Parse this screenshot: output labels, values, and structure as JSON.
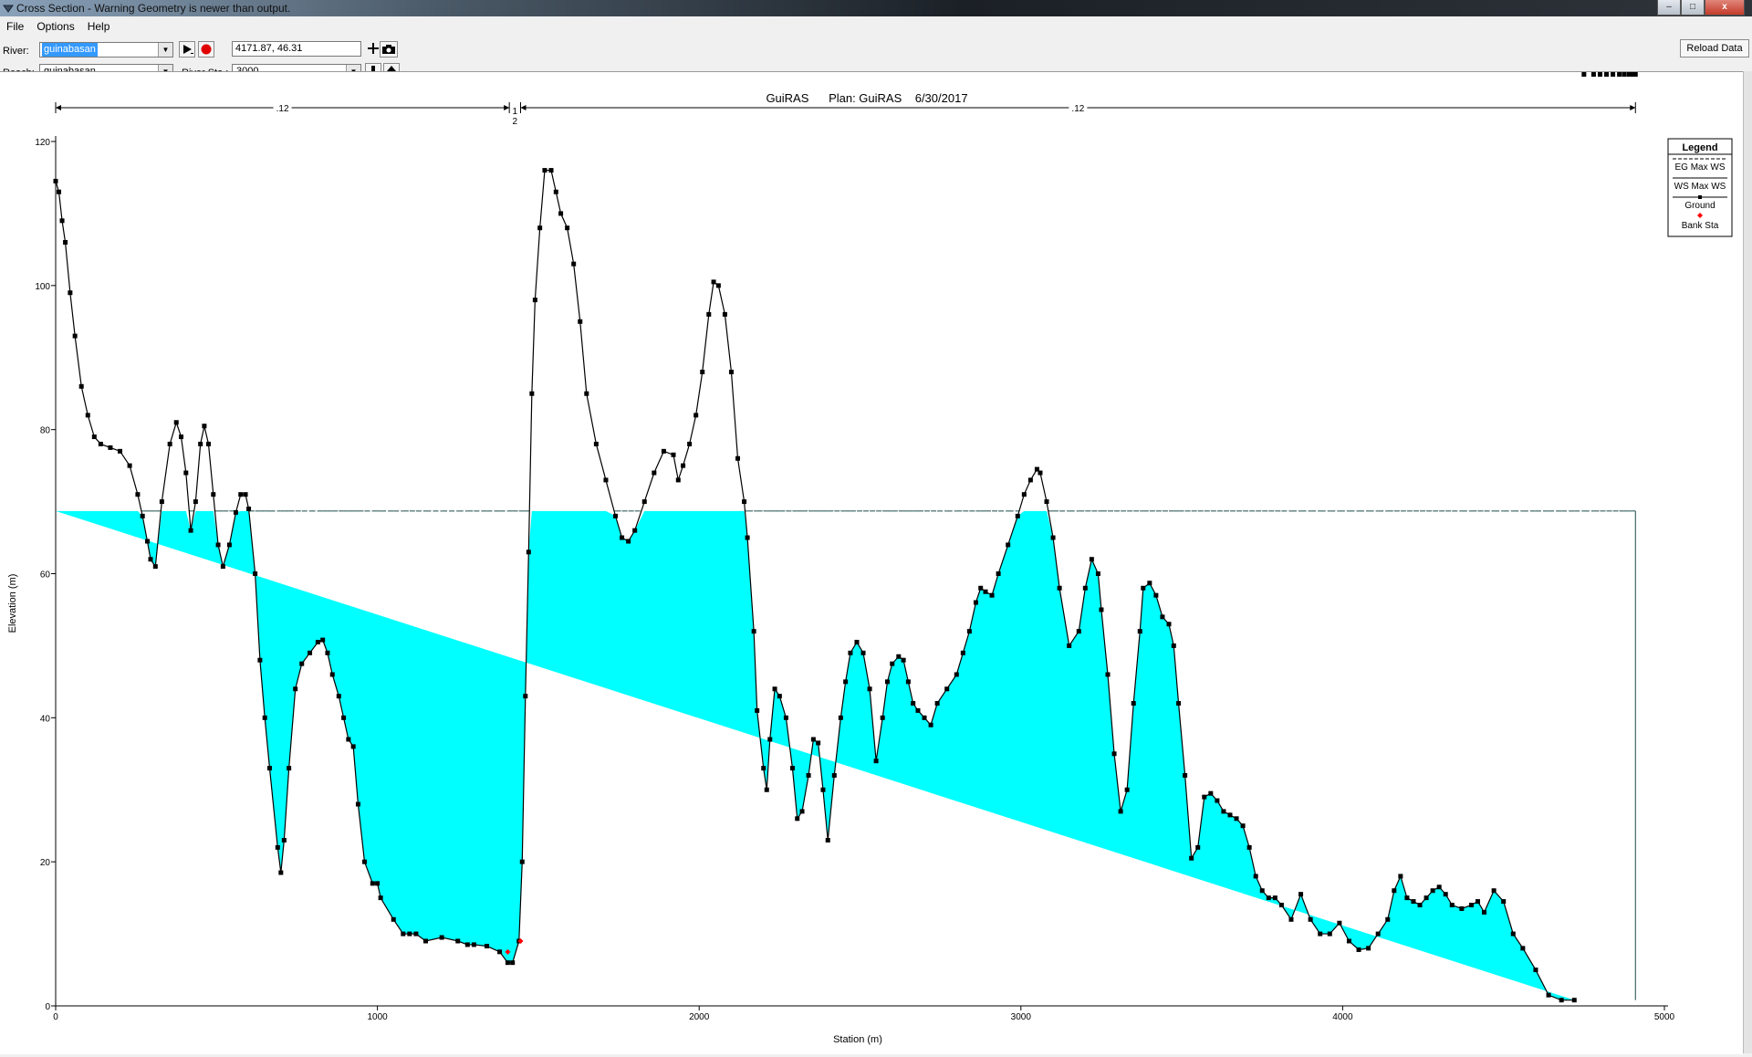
{
  "window": {
    "title": "Cross Section - Warning Geometry is newer than output.",
    "minimize": "–",
    "maximize": "□",
    "close": "x"
  },
  "menu": [
    "File",
    "Options",
    "Help"
  ],
  "controls": {
    "river_label": "River:",
    "river_value": "guinabasan",
    "reach_label": "Reach:",
    "reach_value": "guinabasan",
    "river_sta_label": "River Sta.:",
    "river_sta_value": "3000",
    "coordinates": "4171.87, 46.31",
    "reload_label": "Reload Data",
    "icons": [
      "play-icon",
      "record-icon",
      "plus-icon",
      "camera-icon",
      "down-arrow-icon",
      "up-arrow-icon"
    ]
  },
  "chart_data": {
    "type": "area",
    "title": "GuiRAS      Plan: GuiRAS    6/30/2017",
    "xlabel": "Station (m)",
    "ylabel": "Elevation (m)",
    "xlim": [
      0,
      5000
    ],
    "ylim": [
      0,
      120
    ],
    "xticks": [
      0,
      1000,
      2000,
      3000,
      4000,
      5000
    ],
    "yticks": [
      0,
      20,
      40,
      60,
      80,
      100,
      120
    ],
    "grid": false,
    "water_surface_elevation": 68.7,
    "water_surface_extent": [
      0,
      4910
    ],
    "colors": {
      "water": "#00ffff",
      "ground": "#000000",
      "bank": "#ff0000"
    },
    "manning": [
      {
        "label": ".12",
        "from": 0,
        "to": 1410
      },
      {
        "label": ".12",
        "from": 1445,
        "to": 4910
      }
    ],
    "bank_marker_labels": [
      "1",
      "2"
    ],
    "bank_stations": [
      [
        1405,
        7.5
      ],
      [
        1445,
        9
      ]
    ],
    "legend": {
      "title": "Legend",
      "position": "top-right",
      "entries": [
        "EG Max WS",
        "WS Max WS",
        "Ground",
        "Bank Sta"
      ]
    },
    "ground": {
      "x": [
        0,
        10,
        20,
        30,
        45,
        60,
        80,
        100,
        120,
        140,
        170,
        200,
        230,
        255,
        270,
        285,
        295,
        310,
        330,
        355,
        375,
        390,
        405,
        420,
        435,
        450,
        462,
        475,
        490,
        505,
        520,
        540,
        560,
        575,
        590,
        600,
        620,
        635,
        650,
        665,
        690,
        700,
        710,
        725,
        745,
        765,
        790,
        815,
        830,
        845,
        860,
        880,
        895,
        910,
        925,
        940,
        960,
        985,
        1000,
        1010,
        1050,
        1080,
        1100,
        1120,
        1150,
        1200,
        1250,
        1280,
        1300,
        1340,
        1380,
        1405,
        1420,
        1440,
        1450,
        1460,
        1470,
        1480,
        1490,
        1505,
        1520,
        1540,
        1555,
        1570,
        1590,
        1610,
        1630,
        1650,
        1680,
        1710,
        1740,
        1760,
        1780,
        1800,
        1830,
        1860,
        1890,
        1920,
        1935,
        1950,
        1970,
        1990,
        2010,
        2030,
        2045,
        2060,
        2080,
        2100,
        2120,
        2140,
        2150,
        2170,
        2180,
        2200,
        2210,
        2220,
        2235,
        2250,
        2270,
        2290,
        2305,
        2320,
        2340,
        2355,
        2370,
        2385,
        2400,
        2420,
        2440,
        2455,
        2470,
        2490,
        2510,
        2530,
        2550,
        2570,
        2585,
        2600,
        2620,
        2635,
        2650,
        2665,
        2680,
        2700,
        2720,
        2740,
        2770,
        2800,
        2820,
        2840,
        2860,
        2875,
        2890,
        2910,
        2930,
        2960,
        2990,
        3010,
        3030,
        3050,
        3060,
        3080,
        3100,
        3120,
        3150,
        3180,
        3200,
        3220,
        3240,
        3250,
        3270,
        3290,
        3310,
        3330,
        3350,
        3370,
        3380,
        3400,
        3420,
        3440,
        3460,
        3475,
        3490,
        3510,
        3530,
        3550,
        3570,
        3590,
        3610,
        3630,
        3650,
        3670,
        3690,
        3710,
        3730,
        3750,
        3770,
        3790,
        3810,
        3840,
        3870,
        3900,
        3930,
        3960,
        3990,
        4020,
        4050,
        4080,
        4110,
        4140,
        4160,
        4180,
        4200,
        4220,
        4240,
        4260,
        4280,
        4300,
        4320,
        4340,
        4370,
        4400,
        4420,
        4440,
        4470,
        4500,
        4530,
        4560,
        4600,
        4640,
        4680,
        4720,
        4750,
        4780,
        4800,
        4820,
        4840,
        4860,
        4875,
        4890,
        4900,
        4910
      ],
      "y": [
        114.5,
        113,
        109,
        106,
        99,
        93,
        86,
        82,
        79,
        78,
        77.5,
        77,
        75,
        71,
        68,
        64.5,
        62,
        61,
        70,
        78,
        81,
        79,
        74,
        66,
        70,
        78,
        80.5,
        78,
        71,
        64,
        61,
        64,
        68.5,
        71,
        71,
        69,
        60,
        48,
        40,
        33,
        22,
        18.5,
        23,
        33,
        44,
        47.5,
        49,
        50.5,
        50.8,
        49,
        46,
        43,
        40,
        37,
        36,
        28,
        20,
        17,
        17,
        15,
        12,
        10,
        10,
        10,
        9,
        9.5,
        9,
        8.5,
        8.5,
        8.3,
        7.5,
        6,
        6,
        9,
        20,
        43,
        63,
        85,
        98,
        108,
        116,
        116,
        113,
        110,
        108,
        103,
        95,
        85,
        78,
        73,
        68,
        65,
        64.5,
        66,
        70,
        74,
        77,
        76.5,
        73,
        75,
        78,
        82,
        88,
        96,
        100.5,
        100,
        96,
        88,
        76,
        70,
        65,
        52,
        41,
        33,
        30,
        37,
        44,
        43,
        40,
        33,
        26,
        27,
        32,
        37,
        36.5,
        30,
        23,
        32,
        40,
        45,
        49,
        50.5,
        49,
        44,
        34,
        40,
        45,
        47.5,
        48.5,
        48,
        45,
        42,
        41,
        40,
        39,
        42,
        44,
        46,
        49,
        52,
        56,
        58,
        57.5,
        57,
        60,
        64,
        68,
        71,
        73,
        74.5,
        74,
        70,
        65,
        58,
        50,
        52,
        58,
        62,
        60,
        55,
        46,
        35,
        27,
        30,
        42,
        52,
        58,
        58.7,
        57,
        54,
        53,
        50,
        42,
        32,
        20.5,
        22,
        29,
        29.5,
        28.5,
        27,
        26.5,
        26,
        25,
        22,
        18,
        16,
        15,
        15,
        14,
        12,
        15.5,
        12,
        10,
        10,
        11.5,
        9,
        7.8,
        8,
        10,
        12,
        16,
        18,
        15,
        14.5,
        14,
        15,
        16,
        16.5,
        15.5,
        14,
        13.5,
        14,
        14.5,
        13,
        16,
        14.5,
        10,
        8,
        5,
        1.5,
        0.8,
        0.8
      ]
    }
  }
}
